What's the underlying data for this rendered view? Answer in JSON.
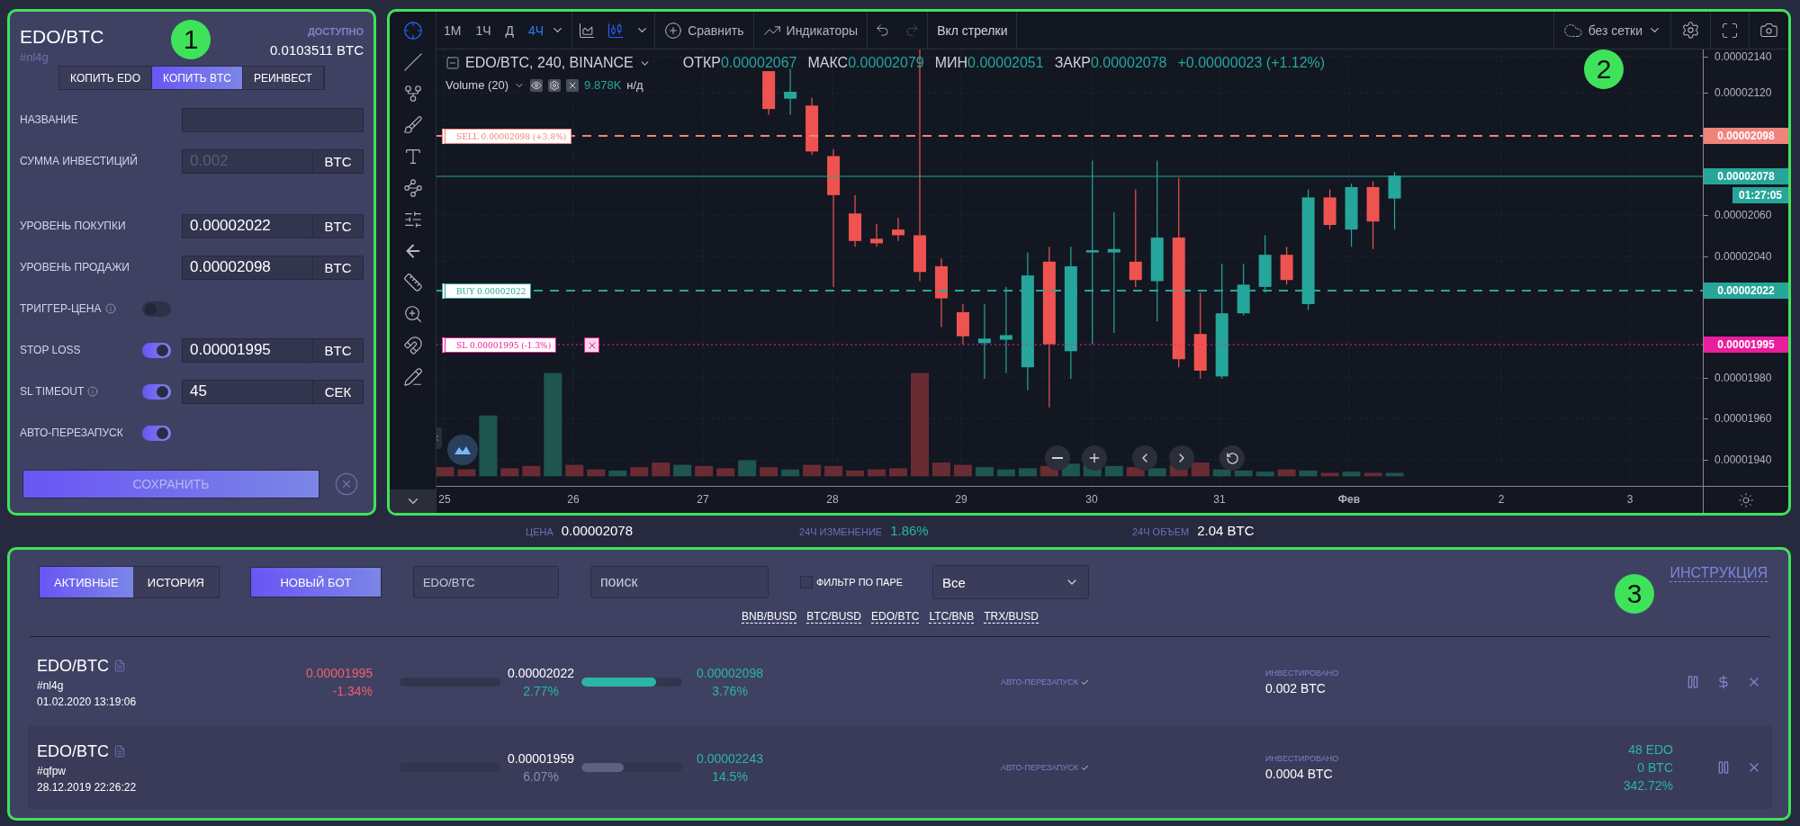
{
  "settings_panel": {
    "callout": "1",
    "pair": "EDO/BTC",
    "tag": "#nl4g",
    "available_label": "ДОСТУПНО",
    "available_value": "0.0103511 BTC",
    "modes": [
      {
        "label": "КОПИТЬ EDO",
        "selected": false
      },
      {
        "label": "КОПИТЬ BTC",
        "selected": true
      },
      {
        "label": "РЕИНВЕСТ",
        "selected": false
      }
    ],
    "fields": [
      {
        "kind": "text",
        "label": "НАЗВАНИЕ"
      },
      {
        "kind": "amount",
        "label": "СУММА ИНВЕСТИЦИЙ",
        "placeholder": "0.002",
        "unit": "BTC"
      },
      {
        "kind": "price",
        "label": "УРОВЕНЬ ПОКУПКИ",
        "value": "0.00002022",
        "unit": "BTC"
      },
      {
        "kind": "price",
        "label": "УРОВЕНЬ ПРОДАЖИ",
        "value": "0.00002098",
        "unit": "BTC"
      },
      {
        "kind": "toggle",
        "label": "ТРИГГЕР-ЦЕНА",
        "info": true,
        "on": false
      },
      {
        "kind": "toggle_price",
        "label": "STOP LOSS",
        "info": false,
        "on": true,
        "value": "0.00001995",
        "unit": "BTC"
      },
      {
        "kind": "toggle_price",
        "label": "SL TIMEOUT",
        "info": true,
        "on": true,
        "value": "45",
        "unit": "СЕК"
      },
      {
        "kind": "toggle",
        "label": "АВТО-ПЕРЕЗАПУСК",
        "info": false,
        "on": true
      }
    ],
    "save_button": "СОХРАНИТЬ"
  },
  "chart_panel": {
    "callout": "2",
    "intervals": [
      {
        "label": "1М",
        "selected": false
      },
      {
        "label": "1Ч",
        "selected": false
      },
      {
        "label": "Д",
        "selected": false
      },
      {
        "label": "4Ч",
        "selected": true
      }
    ],
    "compare": "Сравнить",
    "indicators": "Индикаторы",
    "arrows_toggle": "Вкл стрелки",
    "grid_menu": "без сетки",
    "legend": {
      "symbol": "EDO/BTC, 240, BINANCE",
      "stats": [
        {
          "label": "ОТКР",
          "value": "0.00002067"
        },
        {
          "label": "МАКС",
          "value": "0.00002079"
        },
        {
          "label": "МИН",
          "value": "0.00002051"
        },
        {
          "label": "ЗАКР",
          "value": "0.00002078"
        }
      ],
      "change": "+0.00000023 (+1.12%)",
      "volume_label": "Volume (20)",
      "volume_value": "9.878K",
      "volume_extra": "н/д"
    },
    "order_lines": [
      {
        "kind": "sell",
        "label": "SELL 0.00002098 (+3.8%)",
        "price": "0.00002098",
        "color": "#f0837c",
        "closable": false
      },
      {
        "kind": "buy",
        "label": "BUY 0.00002022",
        "price": "0.00002022",
        "color": "#26a69a",
        "closable": false
      },
      {
        "kind": "stop",
        "label": "SL 0.00001995 (-1.3%)",
        "price": "0.00001995",
        "color": "#e91e9c",
        "closable": true
      }
    ],
    "last_price": {
      "value": "0.00002078",
      "countdown": "01:27:05"
    },
    "y_ticks": [
      "0.00002140",
      "0.00002120",
      "0.00002060",
      "0.00002040",
      "0.00001980",
      "0.00001960",
      "0.00001940"
    ],
    "x_ticks": [
      "25",
      "26",
      "27",
      "28",
      "29",
      "30",
      "31",
      "Фев",
      "2",
      "3"
    ]
  },
  "stats_bar": [
    {
      "label": "ЦЕНА",
      "value": "0.00002078",
      "kind": "plain"
    },
    {
      "label": "24Ч ИЗМЕНЕНИЕ",
      "value": "1.86%",
      "kind": "up"
    },
    {
      "label": "24Ч ОБЪЕМ",
      "value": "2.04 BTC",
      "kind": "plain"
    }
  ],
  "bots_panel": {
    "callout": "3",
    "tabs": [
      {
        "label": "АКТИВНЫЕ",
        "selected": true
      },
      {
        "label": "ИСТОРИЯ",
        "selected": false
      }
    ],
    "new_bot": "НОВЫЙ БОТ",
    "pair_field": {
      "placeholder": "EDO/BTC"
    },
    "search_field": {
      "placeholder": "поиск"
    },
    "pair_filter": {
      "label": "ФИЛЬТР ПО ПАРЕ",
      "checked": false
    },
    "status_select": "Все",
    "help_link": "ИНСТРУКЦИЯ",
    "pairs": [
      "BNB/BUSD",
      "BTC/BUSD",
      "EDO/BTC",
      "LTC/BNB",
      "TRX/BUSD"
    ],
    "bots": [
      {
        "pair": "EDO/BTC",
        "tag": "#nl4g",
        "created": "01.02.2020 13:19:06",
        "stop_price": "0.00001995",
        "stop_change": "-1.34%",
        "stop_bar": {
          "level": 0
        },
        "buy_price": "0.00002022",
        "buy_change": "2.77%",
        "buy_reached": true,
        "sell_bar": {
          "level": 0.74
        },
        "sell_price": "0.00002098",
        "sell_change": "3.76%",
        "auto_restart": "АВТО-ПЕРЕЗАПУСК",
        "invested_label": "ИНВЕСТИРОВАНО",
        "invested": "0.002 BTC",
        "can_withdraw": true
      },
      {
        "pair": "EDO/BTC",
        "tag": "#qfpw",
        "created": "28.12.2019 22:26:22",
        "stop_bar": {
          "level": 0
        },
        "buy_price": "0.00001959",
        "buy_change": "6.07%",
        "buy_reached": false,
        "sell_bar": {
          "level": 0.42
        },
        "sell_price": "0.00002243",
        "sell_change": "14.5%",
        "auto_restart": "АВТО-ПЕРЕЗАПУСК",
        "invested_label": "ИНВЕСТИРОВАНО",
        "invested": "0.0004 BTC",
        "balances": [
          "48 EDO",
          "0 BTC",
          "342.72%"
        ],
        "can_withdraw": false
      }
    ]
  }
}
